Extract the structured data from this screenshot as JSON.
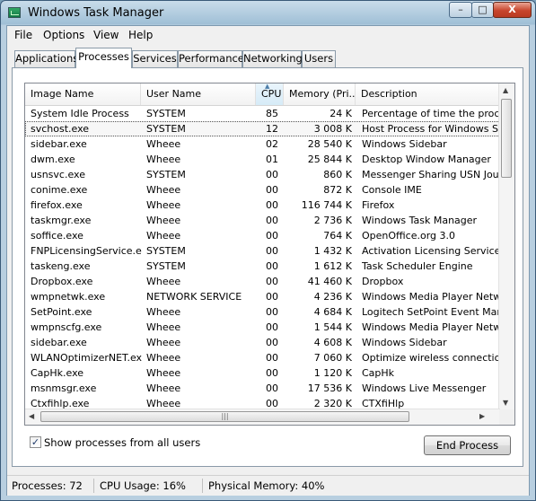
{
  "window": {
    "title": "Windows Task Manager",
    "controls": {
      "minimize": "–",
      "maximize": "□",
      "close": "X"
    }
  },
  "menu": [
    "File",
    "Options",
    "View",
    "Help"
  ],
  "tabs": [
    "Applications",
    "Processes",
    "Services",
    "Performance",
    "Networking",
    "Users"
  ],
  "active_tab": "Processes",
  "columns": [
    "Image Name",
    "User Name",
    "CPU",
    "Memory (Pri...",
    "Description"
  ],
  "sorted_column": "CPU",
  "processes": [
    {
      "name": "System Idle Process",
      "user": "SYSTEM",
      "cpu": "85",
      "memory": "24 K",
      "description": "Percentage of time the proces"
    },
    {
      "name": "svchost.exe",
      "user": "SYSTEM",
      "cpu": "12",
      "memory": "3 008 K",
      "description": "Host Process for Windows Ser",
      "selected": true
    },
    {
      "name": "sidebar.exe",
      "user": "Wheee",
      "cpu": "02",
      "memory": "28 540 K",
      "description": "Windows Sidebar"
    },
    {
      "name": "dwm.exe",
      "user": "Wheee",
      "cpu": "01",
      "memory": "25 844 K",
      "description": "Desktop Window Manager"
    },
    {
      "name": "usnsvc.exe",
      "user": "SYSTEM",
      "cpu": "00",
      "memory": "860 K",
      "description": "Messenger Sharing USN Journ"
    },
    {
      "name": "conime.exe",
      "user": "Wheee",
      "cpu": "00",
      "memory": "872 K",
      "description": "Console IME"
    },
    {
      "name": "firefox.exe",
      "user": "Wheee",
      "cpu": "00",
      "memory": "116 744 K",
      "description": "Firefox"
    },
    {
      "name": "taskmgr.exe",
      "user": "Wheee",
      "cpu": "00",
      "memory": "2 736 K",
      "description": "Windows Task Manager"
    },
    {
      "name": "soffice.exe",
      "user": "Wheee",
      "cpu": "00",
      "memory": "764 K",
      "description": "OpenOffice.org 3.0"
    },
    {
      "name": "FNPLicensingService.exe",
      "user": "SYSTEM",
      "cpu": "00",
      "memory": "1 432 K",
      "description": "Activation Licensing Service"
    },
    {
      "name": "taskeng.exe",
      "user": "SYSTEM",
      "cpu": "00",
      "memory": "1 612 K",
      "description": "Task Scheduler Engine"
    },
    {
      "name": "Dropbox.exe",
      "user": "Wheee",
      "cpu": "00",
      "memory": "41 460 K",
      "description": "Dropbox"
    },
    {
      "name": "wmpnetwk.exe",
      "user": "NETWORK SERVICE",
      "cpu": "00",
      "memory": "4 236 K",
      "description": "Windows Media Player Netwo"
    },
    {
      "name": "SetPoint.exe",
      "user": "Wheee",
      "cpu": "00",
      "memory": "4 684 K",
      "description": "Logitech SetPoint Event Mana"
    },
    {
      "name": "wmpnscfg.exe",
      "user": "Wheee",
      "cpu": "00",
      "memory": "1 544 K",
      "description": "Windows Media Player Netwo"
    },
    {
      "name": "sidebar.exe",
      "user": "Wheee",
      "cpu": "00",
      "memory": "4 608 K",
      "description": "Windows Sidebar"
    },
    {
      "name": "WLANOptimizerNET.exe",
      "user": "Wheee",
      "cpu": "00",
      "memory": "7 060 K",
      "description": "Optimize wireless connections"
    },
    {
      "name": "CapHk.exe",
      "user": "Wheee",
      "cpu": "00",
      "memory": "1 120 K",
      "description": "CapHk"
    },
    {
      "name": "msnmsgr.exe",
      "user": "Wheee",
      "cpu": "00",
      "memory": "17 536 K",
      "description": "Windows Live Messenger"
    },
    {
      "name": "Ctxfihlp.exe",
      "user": "Wheee",
      "cpu": "00",
      "memory": "2 320 K",
      "description": "CTXfiHlp"
    }
  ],
  "show_all_users": {
    "label": "Show processes from all users",
    "checked": true,
    "mark": "✓"
  },
  "end_process_label": "End Process",
  "status": {
    "processes": "Processes: 72",
    "cpu_usage": "CPU Usage: 16%",
    "physical_memory": "Physical Memory: 40%"
  },
  "icons": {
    "scroll_up": "▲",
    "scroll_down": "▼",
    "scroll_left": "◀",
    "scroll_right": "▶",
    "sort_indicator": "▲",
    "grip": "|||"
  }
}
